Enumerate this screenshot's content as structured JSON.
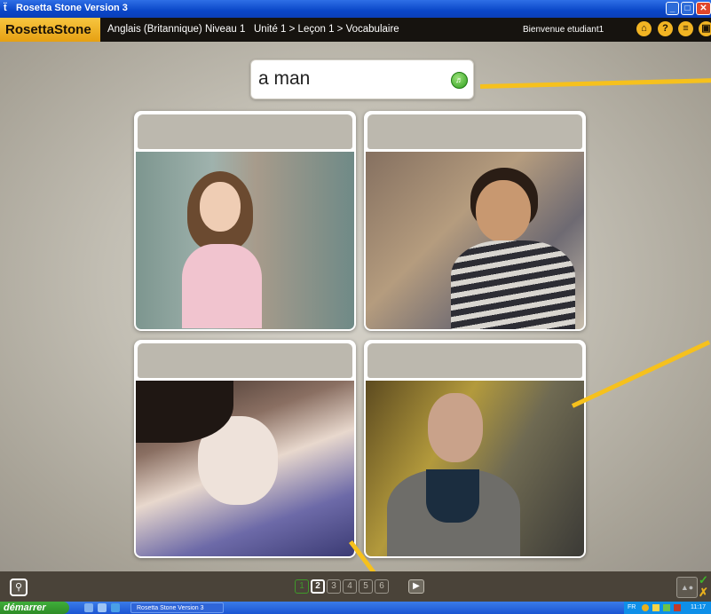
{
  "window": {
    "title": "Rosetta Stone Version 3"
  },
  "topbar": {
    "brand": "RosettaStone",
    "course": "Anglais (Britannique) Niveau 1",
    "breadcrumb": "Unité 1 > Leçon 1 > Vocabulaire",
    "welcome": "Bienvenue etudiant1"
  },
  "prompt": {
    "text": "a man"
  },
  "pager": {
    "pages": [
      "1",
      "2",
      "3",
      "4",
      "5",
      "6"
    ],
    "current": "2"
  },
  "taskbar": {
    "start_label": "démarrer",
    "task_label": "Rosetta Stone Version 3",
    "lang": "FR",
    "clock": "11:17"
  },
  "colors": {
    "accent_yellow": "#f6c11d",
    "topbar": "#16130f",
    "logo": "#f0b32a",
    "correct": "#3fb52a"
  }
}
